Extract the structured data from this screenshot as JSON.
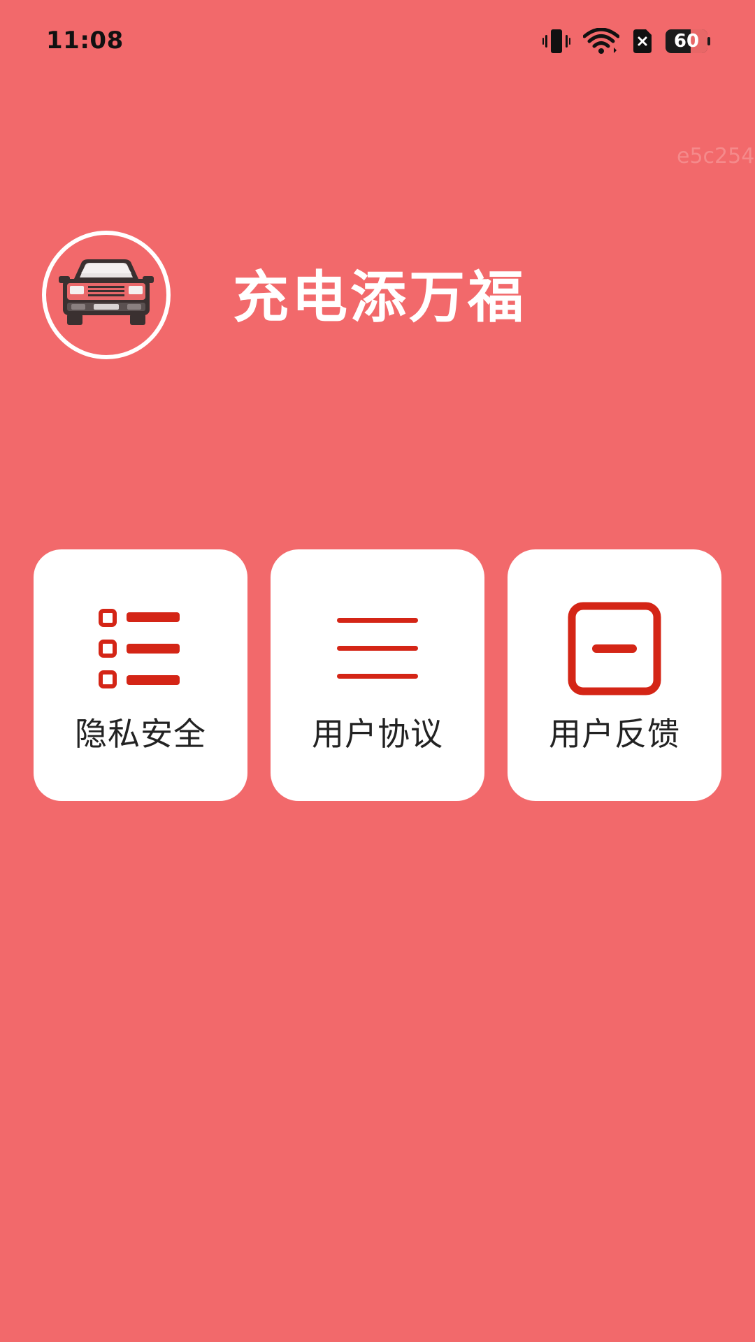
{
  "status_bar": {
    "time": "11:08",
    "battery_level": "60",
    "icons": [
      "vibrate-icon",
      "wifi-icon",
      "no-sim-icon",
      "battery-icon"
    ]
  },
  "watermark": "e5c254",
  "app": {
    "title": "充电添万福",
    "logo_icon": "car-icon"
  },
  "menu": {
    "items": [
      {
        "label": "隐私安全",
        "icon": "list-icon"
      },
      {
        "label": "用户协议",
        "icon": "menu-lines-icon"
      },
      {
        "label": "用户反馈",
        "icon": "square-minus-icon"
      }
    ]
  },
  "colors": {
    "background": "#f2696b",
    "accent": "#d42516",
    "card": "#ffffff",
    "text_dark": "#222222"
  }
}
